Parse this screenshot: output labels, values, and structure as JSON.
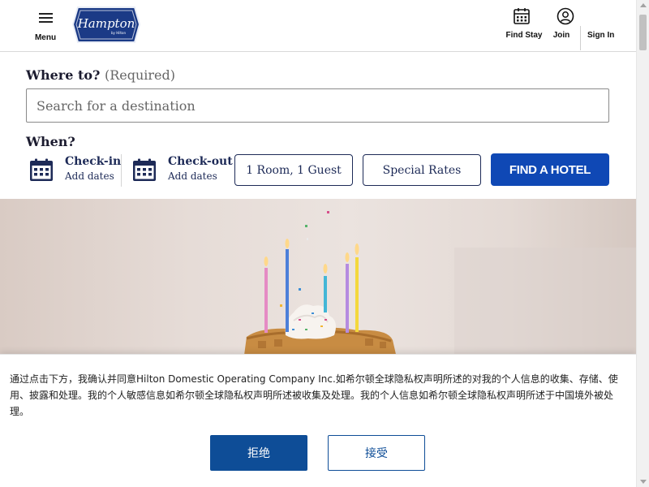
{
  "header": {
    "menu_label": "Menu",
    "logo_text": "Hampton",
    "logo_subtext": "by Hilton",
    "links": [
      {
        "label": "Find Stay",
        "icon": "calendar-icon"
      },
      {
        "label": "Join",
        "icon": "user-circle-icon"
      },
      {
        "label": "Sign In",
        "icon": ""
      }
    ]
  },
  "search": {
    "where_label": "Where to?",
    "where_required": "(Required)",
    "destination_placeholder": "Search for a destination",
    "destination_value": "",
    "when_label": "When?",
    "checkin_label": "Check-in",
    "checkin_value": "Add dates",
    "checkout_label": "Check-out",
    "checkout_value": "Add dates",
    "rooms_label": "1 Room, 1 Guest",
    "rates_label": "Special Rates",
    "find_label": "FIND A HOTEL"
  },
  "hero": {
    "image": "birthday waffle with candles"
  },
  "consent": {
    "message": "通过点击下方，我确认并同意Hilton Domestic Operating Company Inc.如希尔顿全球隐私权声明所述的对我的个人信息的收集、存储、使用、披露和处理。我的个人敏感信息如希尔顿全球隐私权声明所述被收集及处理。我的个人信息如希尔顿全球隐私权声明所述于中国境外被处理。",
    "reject_label": "拒绝",
    "accept_label": "接受"
  },
  "colors": {
    "brand_navy": "#1d2a57",
    "primary_blue": "#0f48b5",
    "consent_blue": "#0e4d97"
  }
}
